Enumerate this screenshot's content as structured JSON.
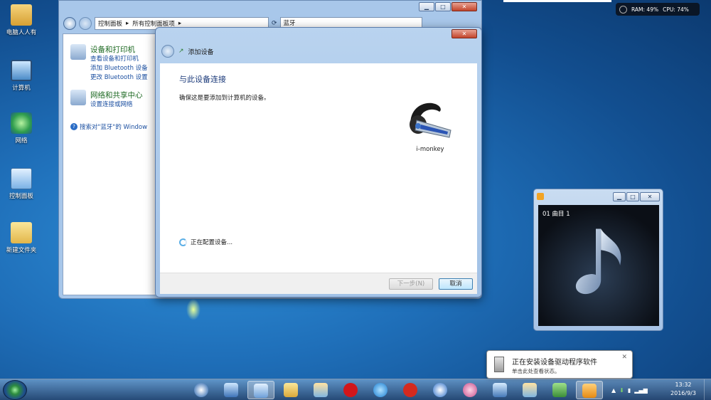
{
  "desktop": {
    "icons": [
      {
        "label": "电脑人人有",
        "icon": "user-folder-icon"
      },
      {
        "label": "计算机",
        "icon": "computer-icon"
      },
      {
        "label": "网络",
        "icon": "network-icon"
      },
      {
        "label": "控制面板",
        "icon": "control-panel-icon"
      },
      {
        "label": "新建文件夹",
        "icon": "folder-icon"
      }
    ]
  },
  "sysmon": {
    "ram": "RAM: 49%",
    "cpu": "CPU: 74%"
  },
  "control_panel": {
    "breadcrumb": [
      "控制面板",
      "所有控制面板项"
    ],
    "search_value": "蓝牙",
    "categories": [
      {
        "title": "设备和打印机",
        "links": [
          "查看设备和打印机",
          "添加 Bluetooth 设备",
          "更改 Bluetooth 设置"
        ]
      },
      {
        "title": "网络和共享中心",
        "links": [
          "设置连接或网络"
        ]
      }
    ],
    "search_windows_link": "搜索对\"蓝牙\"的 Window"
  },
  "add_device": {
    "title": "添加设备",
    "heading": "与此设备连接",
    "description": "确保这是要添加到计算机的设备。",
    "device_name": "i-monkey",
    "status": "正在配置设备...",
    "next_button": "下一步(N)",
    "cancel_button": "取消"
  },
  "media_player": {
    "track": "01 曲目 1"
  },
  "notification": {
    "title": "正在安装设备驱动程序软件",
    "subtitle": "单击此处查看状态。"
  },
  "clock": {
    "time": "13:32",
    "date": "2016/9/3"
  },
  "colors": {
    "accent": "#1b4fa0",
    "category_green": "#1e6a23",
    "dialog_heading": "#1b3a7a"
  }
}
